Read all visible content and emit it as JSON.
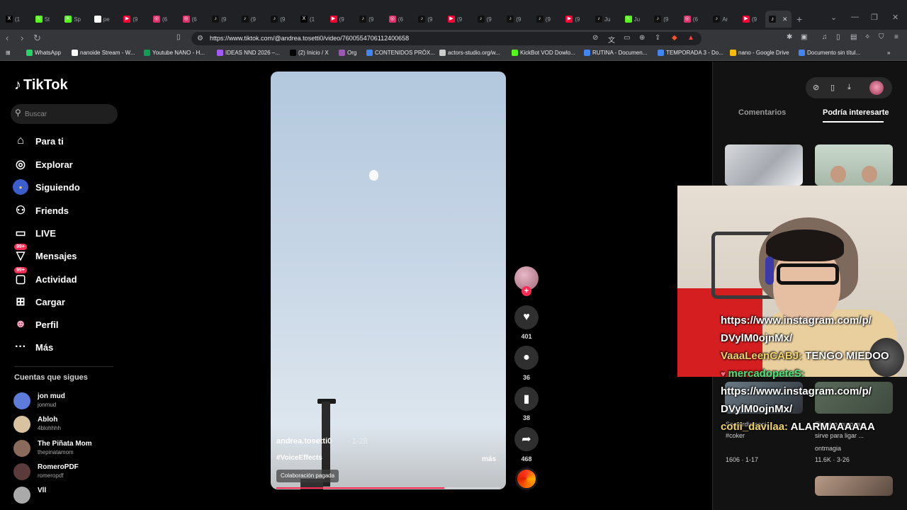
{
  "browser": {
    "tabs": [
      {
        "label": "(1",
        "color": "#000000",
        "glyph": "X"
      },
      {
        "label": "St",
        "color": "#53fc18",
        "glyph": "K"
      },
      {
        "label": "Sp",
        "color": "#53fc18",
        "glyph": "K"
      },
      {
        "label": "pe",
        "color": "#ffffff",
        "glyph": "G"
      },
      {
        "label": "(9",
        "color": "#ff0033",
        "glyph": "▶"
      },
      {
        "label": "(6",
        "color": "#e1306c",
        "glyph": "◎"
      },
      {
        "label": "(6",
        "color": "#e1306c",
        "glyph": "◎"
      },
      {
        "label": "(9",
        "color": "#111111",
        "glyph": "♪"
      },
      {
        "label": "(9",
        "color": "#111111",
        "glyph": "♪"
      },
      {
        "label": "(9",
        "color": "#111111",
        "glyph": "♪"
      },
      {
        "label": "(1",
        "color": "#000000",
        "glyph": "X"
      },
      {
        "label": "(9",
        "color": "#ff0033",
        "glyph": "▶"
      },
      {
        "label": "(9",
        "color": "#111111",
        "glyph": "♪"
      },
      {
        "label": "(6",
        "color": "#e1306c",
        "glyph": "◎"
      },
      {
        "label": "(9",
        "color": "#111111",
        "glyph": "♪"
      },
      {
        "label": "(9",
        "color": "#ff0033",
        "glyph": "▶"
      },
      {
        "label": "(9",
        "color": "#111111",
        "glyph": "♪"
      },
      {
        "label": "(9",
        "color": "#111111",
        "glyph": "♪"
      },
      {
        "label": "(9",
        "color": "#111111",
        "glyph": "♪"
      },
      {
        "label": "(9",
        "color": "#ff0033",
        "glyph": "▶"
      },
      {
        "label": "Ju",
        "color": "#111111",
        "glyph": "♪"
      },
      {
        "label": "Ju",
        "color": "#53fc18",
        "glyph": "K"
      },
      {
        "label": "(9",
        "color": "#111111",
        "glyph": "♪"
      },
      {
        "label": "(6",
        "color": "#e1306c",
        "glyph": "◎"
      },
      {
        "label": "Ar",
        "color": "#111111",
        "glyph": "♪"
      },
      {
        "label": "(9",
        "color": "#ff0033",
        "glyph": "▶"
      }
    ],
    "active_tab_glyph": "♪",
    "url": "https://www.tiktok.com/@andrea.tosetti0/video/7600554706112400658",
    "bookmarks": [
      {
        "label": "WhatsApp",
        "color": "#25d366"
      },
      {
        "label": "nanoide Stream - W...",
        "color": "#ffffff"
      },
      {
        "label": "Youtube NANO - H...",
        "color": "#0f9d58"
      },
      {
        "label": "IDEAS NND 2026 –...",
        "color": "#a259ff"
      },
      {
        "label": "(2) Inicio / X",
        "color": "#000000"
      },
      {
        "label": "Org",
        "color": "#9b59b6"
      },
      {
        "label": "CONTENIDOS PRÓX...",
        "color": "#4285f4"
      },
      {
        "label": "actors-studio.org/w...",
        "color": "#cccccc"
      },
      {
        "label": "KickBot VOD Dowlo...",
        "color": "#53fc18"
      },
      {
        "label": "RUTINA - Documen...",
        "color": "#4285f4"
      },
      {
        "label": "TEMPORADA 3 - Do...",
        "color": "#4285f4"
      },
      {
        "label": "nano - Google Drive",
        "color": "#fbbc04"
      },
      {
        "label": "Documento sin títul...",
        "color": "#4285f4"
      }
    ]
  },
  "tiktok": {
    "logo_text": "TikTok",
    "search_placeholder": "Buscar",
    "nav": [
      {
        "label": "Para ti",
        "icon": "home-icon",
        "glyph": "⌂"
      },
      {
        "label": "Explorar",
        "icon": "compass-icon",
        "glyph": "◎"
      },
      {
        "label": "Siguiendo",
        "icon": "following-icon",
        "glyph": "●"
      },
      {
        "label": "Friends",
        "icon": "friends-icon",
        "glyph": "⚇"
      },
      {
        "label": "LIVE",
        "icon": "live-icon",
        "glyph": "▭"
      },
      {
        "label": "Mensajes",
        "icon": "messages-icon",
        "glyph": "▽",
        "badge": "99+"
      },
      {
        "label": "Actividad",
        "icon": "activity-icon",
        "glyph": "▢",
        "badge": "99+"
      },
      {
        "label": "Cargar",
        "icon": "upload-icon",
        "glyph": "⊞"
      },
      {
        "label": "Perfil",
        "icon": "profile-icon",
        "glyph": "☻"
      },
      {
        "label": "Más",
        "icon": "more-icon",
        "glyph": "···"
      }
    ],
    "following_title": "Cuentas que sigues",
    "following": [
      {
        "name": "jon mud",
        "username": "jonmud",
        "color": "#5d7bd8"
      },
      {
        "name": "Abloh",
        "username": "4blohhhh",
        "color": "#d9c2a0"
      },
      {
        "name": "The Piñata Mom",
        "username": "thepinatamom",
        "color": "#8a6a5a"
      },
      {
        "name": "RomeroPDF",
        "username": "romeropdf",
        "color": "#5a3a3a"
      },
      {
        "name": "Vll",
        "username": "",
        "color": "#aaaaaa"
      }
    ],
    "video": {
      "author": "andrea.tosetti0",
      "date": "· 1-28",
      "hashtag": "#VoiceEffects",
      "more": "más",
      "badge": "Colaboración pagada",
      "progress": 0.75
    },
    "actions": {
      "likes": "401",
      "comments": "36",
      "saves": "38",
      "shares": "468"
    },
    "right_panel": {
      "tab_comments": "Comentarios",
      "tab_recommend": "Podría interesarte"
    },
    "recommended_faded": [
      {
        "title": "Se perdio capi...",
        "meta": "#coker"
      },
      {
        "title": "El único truco que",
        "meta": "sirve para ligar ..."
      },
      {
        "title": "1606 · 1-17",
        "meta": ""
      },
      {
        "title": "11.6K · 3-26",
        "meta": "ontmagia"
      }
    ]
  },
  "stream_overlay": {
    "chat": [
      {
        "user": "",
        "text": "https://www.instagram.com/p/"
      },
      {
        "user": "",
        "text": "DVylM0ojnMx/"
      },
      {
        "user": "VaaaLeenCABJ:",
        "text": " TENGO MIEDOO"
      },
      {
        "user": "mercadopeteS:",
        "text": "",
        "heart": "♥"
      },
      {
        "user": "",
        "text": "https://www.instagram.com/p/"
      },
      {
        "user": "",
        "text": "DVylM0ojnMx/"
      },
      {
        "user": "cotii_davilaa:",
        "text": " ALARMAAAAAA"
      }
    ]
  }
}
